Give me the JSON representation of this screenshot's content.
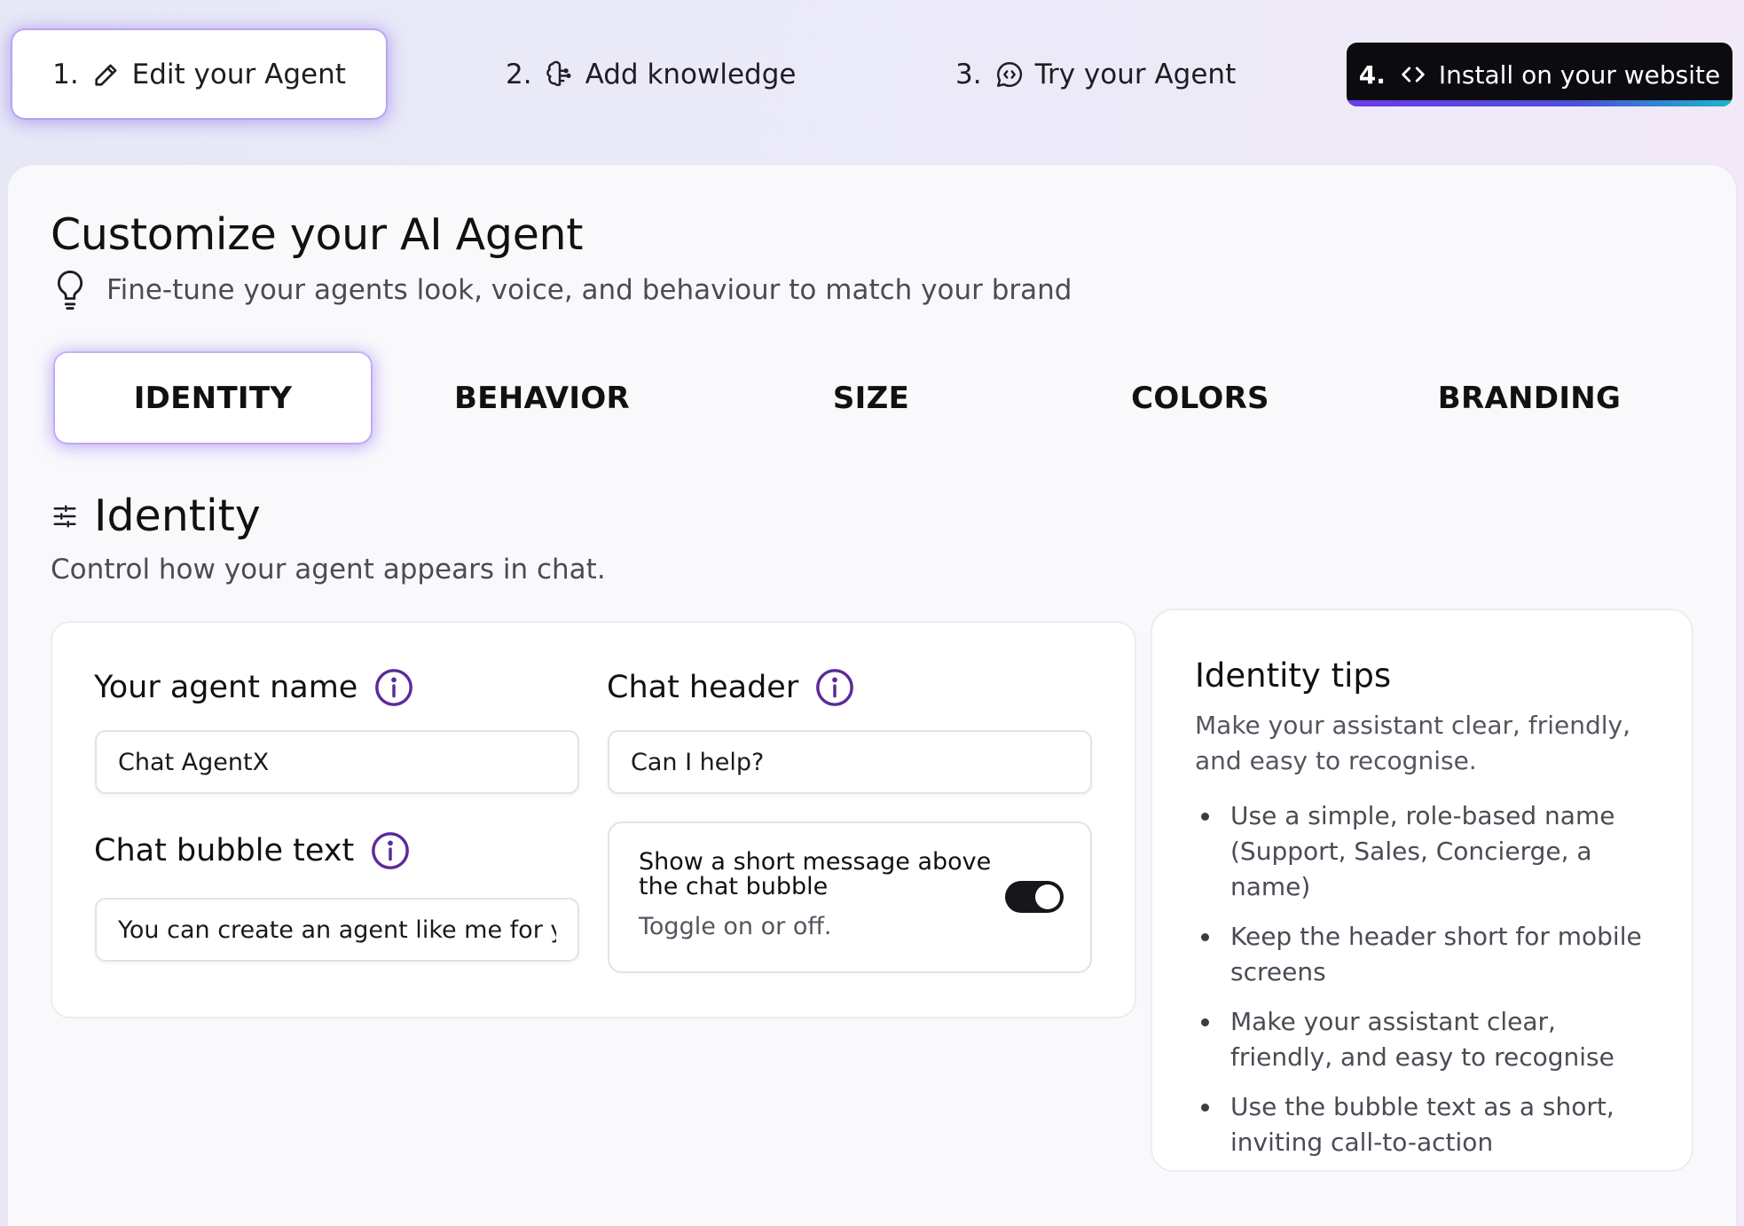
{
  "stepper": {
    "steps": [
      {
        "number": "1.",
        "label": "Edit your Agent",
        "icon": "pencil-icon"
      },
      {
        "number": "2.",
        "label": "Add knowledge",
        "icon": "brain-icon"
      },
      {
        "number": "3.",
        "label": "Try your Agent",
        "icon": "chat-bubble-icon"
      },
      {
        "number": "4.",
        "label": "Install on your website",
        "icon": "code-icon"
      }
    ],
    "active_step": 1
  },
  "header": {
    "title": "Customize your AI Agent",
    "subtitle": "Fine-tune your agents look, voice, and behaviour to match your brand",
    "subtitle_icon": "lightbulb-icon"
  },
  "tabs": {
    "items": [
      {
        "label": "IDENTITY"
      },
      {
        "label": "BEHAVIOR"
      },
      {
        "label": "SIZE"
      },
      {
        "label": "COLORS"
      },
      {
        "label": "BRANDING"
      }
    ],
    "active": "IDENTITY"
  },
  "identity": {
    "icon": "sliders-icon",
    "title": "Identity",
    "description": "Control how your agent appears in chat.",
    "agent_name": {
      "label": "Your agent name",
      "value": "Chat AgentX"
    },
    "chat_header": {
      "label": "Chat header",
      "value": "Can I help?"
    },
    "bubble_text": {
      "label": "Chat bubble text",
      "value": "You can create an agent like me for you"
    },
    "bubble_toggle": {
      "title": "Show a short message above the chat bubble",
      "hint": "Toggle on or off.",
      "on": true
    }
  },
  "tips": {
    "title": "Identity tips",
    "description": "Make your assistant clear, friendly, and easy to recognise.",
    "items": [
      "Use a simple, role-based name (Support, Sales, Concierge, a name)",
      "Keep the header short for mobile screens",
      "Make your assistant clear, friendly, and easy to recognise",
      "Use the bubble text as a short, inviting call-to-action"
    ]
  },
  "colors": {
    "accent": "#7b4ff0",
    "info_icon": "#5b2a9a",
    "dark_button": "#0c0c10",
    "gradient_end": "#19b6cf"
  }
}
